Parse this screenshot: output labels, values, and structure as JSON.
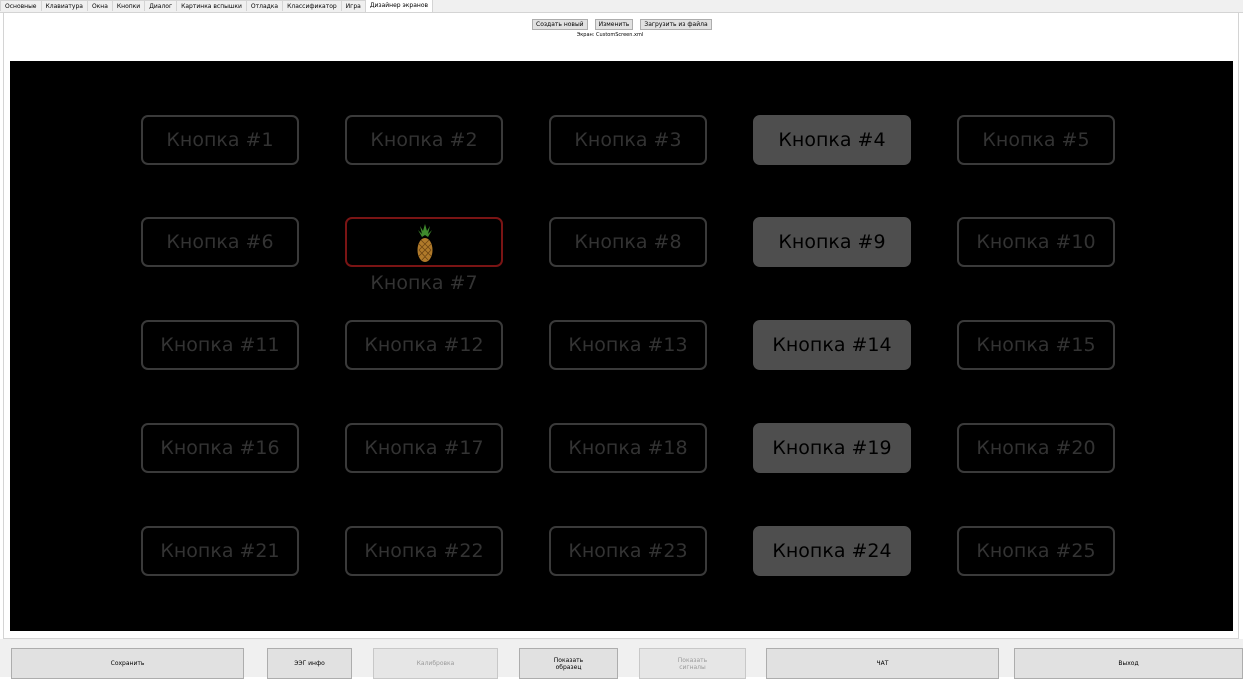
{
  "tabs": [
    {
      "label": "Основные"
    },
    {
      "label": "Клавиатура"
    },
    {
      "label": "Окна"
    },
    {
      "label": "Кнопки"
    },
    {
      "label": "Диалог"
    },
    {
      "label": "Картинка вспышки"
    },
    {
      "label": "Отладка"
    },
    {
      "label": "Классификатор"
    },
    {
      "label": "Игра"
    },
    {
      "label": "Дизайнер экранов",
      "active": true
    }
  ],
  "toolbar": {
    "create_label": "Создать новый",
    "edit_label": "Изменить",
    "load_label": "Загрузить из файла"
  },
  "screen_caption": "Экран: CustomScreen.xml",
  "canvas": {
    "background": "#000000",
    "buttons": [
      "Кнопка #1",
      "Кнопка #2",
      "Кнопка #3",
      "Кнопка #4",
      "Кнопка #5",
      "Кнопка #6",
      "Кнопка #7",
      "Кнопка #8",
      "Кнопка #9",
      "Кнопка #10",
      "Кнопка #11",
      "Кнопка #12",
      "Кнопка #13",
      "Кнопка #14",
      "Кнопка #15",
      "Кнопка #16",
      "Кнопка #17",
      "Кнопка #18",
      "Кнопка #19",
      "Кнопка #20",
      "Кнопка #21",
      "Кнопка #22",
      "Кнопка #23",
      "Кнопка #24",
      "Кнопка #25"
    ],
    "selected_button_icon": "pineapple-icon",
    "selected_border_color": "#7a1414",
    "highlight_color": "#4e4e4e"
  },
  "bottom": {
    "save_label": "Сохранить",
    "eeg_info_label": "ЭЭГ инфо",
    "calibration_label": "Калибровка",
    "show_sample_label": "Показать\nобразец",
    "show_signals_label": "Показать\nсигналы",
    "chat_label": "ЧАТ",
    "exit_label": "Выход"
  }
}
